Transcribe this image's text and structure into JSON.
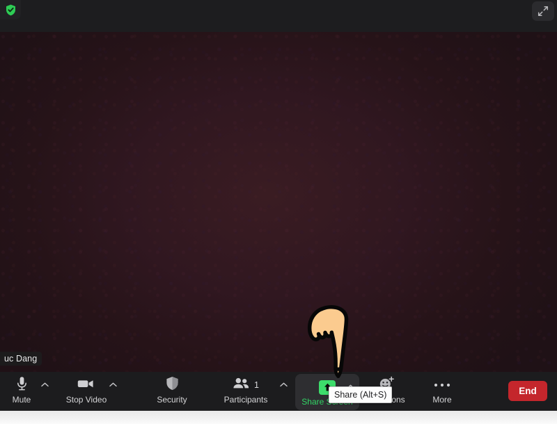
{
  "window": {
    "title_bar": {
      "encryption_icon": "shield-check-icon",
      "encryption_color": "#2ecc55",
      "fullscreen_icon": "fullscreen-expand-icon"
    },
    "video": {
      "participant_name": "uc Dang",
      "background_color": "#2a1418"
    },
    "cursor": {
      "icon": "pointing-down-hand-icon",
      "fill_color": "#fbcb8f",
      "outline_color": "#000000"
    }
  },
  "toolbar": {
    "background_color": "#1c1c1e",
    "items": [
      {
        "id": "mute",
        "label": "Mute",
        "icon": "microphone-icon",
        "has_chevron": true
      },
      {
        "id": "stop-video",
        "label": "Stop Video",
        "icon": "video-camera-icon",
        "has_chevron": true
      },
      {
        "id": "security",
        "label": "Security",
        "icon": "shield-icon",
        "has_chevron": false
      },
      {
        "id": "participants",
        "label": "Participants",
        "icon": "people-icon",
        "count": "1",
        "has_chevron": true
      },
      {
        "id": "share-screen",
        "label": "Share Screen",
        "icon": "share-up-arrow-icon",
        "has_chevron": true,
        "state": "hovered",
        "accent_color": "#3ddc6b"
      },
      {
        "id": "reactions",
        "label": "Reactions",
        "icon": "smiley-plus-icon",
        "has_chevron": false
      },
      {
        "id": "more",
        "label": "More",
        "icon": "ellipsis-icon",
        "has_chevron": false
      }
    ],
    "end_button": {
      "label": "End",
      "color": "#c4262c"
    }
  },
  "tooltip": {
    "text": "Share (Alt+S)"
  }
}
